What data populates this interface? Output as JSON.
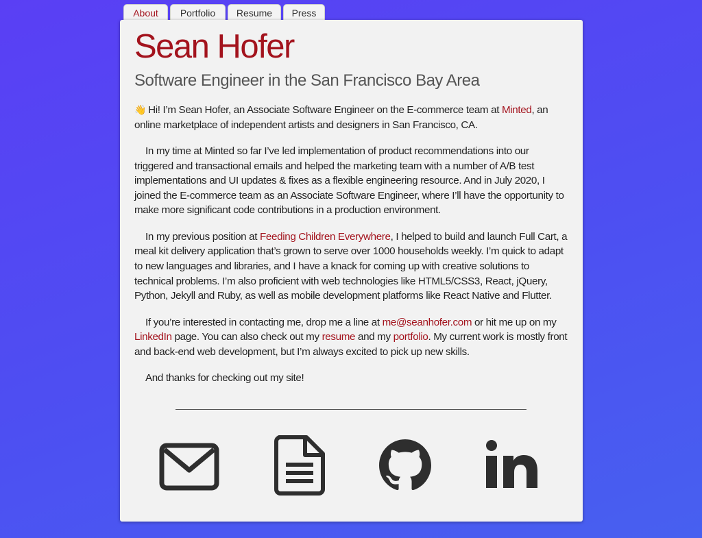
{
  "nav": {
    "tabs": [
      {
        "label": "About",
        "active": true
      },
      {
        "label": "Portfolio",
        "active": false
      },
      {
        "label": "Resume",
        "active": false
      },
      {
        "label": "Press",
        "active": false
      }
    ]
  },
  "profile": {
    "name": "Sean Hofer",
    "tagline": "Software Engineer in the San Francisco Bay Area"
  },
  "about": {
    "p1": {
      "emoji": "👋",
      "text_before": "Hi! I’m Sean Hofer, an Associate Software Engineer on the E-commerce team at ",
      "link_minted": "Minted",
      "text_after": ", an online marketplace of independent artists and designers in San Francisco, CA."
    },
    "p2": "In my time at Minted so far I’ve led implementation of product recommendations into our triggered and transactional emails and helped the marketing team with a number of A/B test implementations and UI updates & fixes as a flexible engineering resource. And in July 2020, I joined the E-commerce team as an Associate Software Engineer, where I’ll have the opportunity to make more significant code contributions in a production environment.",
    "p3": {
      "text_before": "In my previous position at ",
      "link_fce": "Feeding Children Everywhere",
      "text_after": ", I helped to build and launch Full Cart, a meal kit delivery application that’s grown to serve over 1000 households weekly. I’m quick to adapt to new languages and libraries, and I have a knack for coming up with creative solutions to technical problems. I’m also proficient with web technologies like HTML5/CSS3, React, jQuery, Python, Jekyll and Ruby, as well as mobile development platforms like React Native and Flutter."
    },
    "p4": {
      "text_1": "If you’re interested in contacting me, drop me a line at ",
      "link_email": "me@seanhofer.com",
      "text_2": " or hit me up on my ",
      "link_linkedin": "LinkedIn",
      "text_3": " page. You can also check out my ",
      "link_resume": "resume",
      "text_4": " and my ",
      "link_portfolio": "portfolio",
      "text_5": ". My current work is mostly front and back-end web development, but I’m always excited to pick up new skills."
    },
    "p5": "And thanks for checking out my site!"
  },
  "social": {
    "icons": [
      "envelope-icon",
      "document-icon",
      "github-icon",
      "linkedin-icon"
    ]
  },
  "colors": {
    "accent": "#a3131d",
    "card_background": "#f2f2f2",
    "page_background_start": "#5a3ff4",
    "page_background_end": "#4760f0",
    "icon": "#2e2e2e"
  }
}
